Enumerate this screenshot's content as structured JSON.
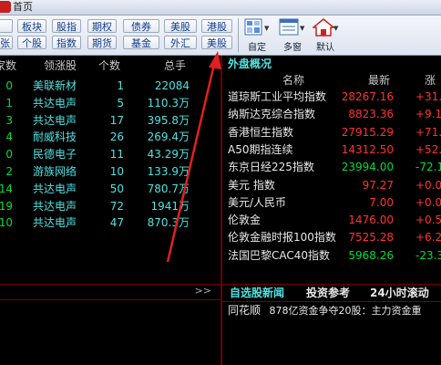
{
  "window": {
    "title_fragment": "首页",
    "logo_fragment": ""
  },
  "toolbar": {
    "row1": [
      "板块",
      "股指",
      "期权",
      "债券",
      "美股",
      "港股"
    ],
    "row2": [
      "个股",
      "指数",
      "期货",
      "基金",
      "外汇",
      "美股"
    ],
    "left_partial_row2": "张",
    "big_buttons": [
      {
        "label": "自定",
        "icon": "grid-icon"
      },
      {
        "label": "多窗",
        "icon": "multi-window-icon"
      },
      {
        "label": "默认",
        "icon": "home-icon"
      }
    ]
  },
  "left_table": {
    "headers": [
      "家数",
      "领涨股",
      "个数",
      "总手"
    ],
    "rows": [
      {
        "count": "0",
        "leader": "美联新材",
        "num": "1",
        "volume": "22084"
      },
      {
        "count": "1",
        "leader": "共达电声",
        "num": "5",
        "volume": "110.3万"
      },
      {
        "count": "3",
        "leader": "共达电声",
        "num": "17",
        "volume": "395.8万"
      },
      {
        "count": "4",
        "leader": "耐威科技",
        "num": "26",
        "volume": "269.4万"
      },
      {
        "count": "0",
        "leader": "民德电子",
        "num": "11",
        "volume": "43.29万"
      },
      {
        "count": "2",
        "leader": "游族网络",
        "num": "10",
        "volume": "133.9万"
      },
      {
        "count": "14",
        "leader": "共达电声",
        "num": "50",
        "volume": "780.7万"
      },
      {
        "count": "19",
        "leader": "共达电声",
        "num": "72",
        "volume": "1941万"
      },
      {
        "count": "10",
        "leader": "共达电声",
        "num": "47",
        "volume": "870.3万"
      }
    ],
    "more_label": ">>"
  },
  "right_table": {
    "title": "外盘概况",
    "headers": [
      "名称",
      "最新",
      "涨"
    ],
    "rows": [
      {
        "name": "道琼斯工业平均指数",
        "latest": "28267.16",
        "change": "+31.2",
        "latest_color": "red",
        "change_color": "red"
      },
      {
        "name": "纳斯达克综合指数",
        "latest": "8823.36",
        "change": "+9.1",
        "latest_color": "red",
        "change_color": "red"
      },
      {
        "name": "香港恒生指数",
        "latest": "27915.29",
        "change": "+71.5",
        "latest_color": "red",
        "change_color": "red"
      },
      {
        "name": "A50期指连续",
        "latest": "14312.50",
        "change": "+52.5",
        "latest_color": "red",
        "change_color": "red"
      },
      {
        "name": "东京日经225指数",
        "latest": "23994.00",
        "change": "-72.1",
        "latest_color": "green",
        "change_color": "green"
      },
      {
        "name": "美元 指数",
        "latest": "97.27",
        "change": "+0.0",
        "latest_color": "red",
        "change_color": "red"
      },
      {
        "name": "美元/人民币",
        "latest": "7.00",
        "change": "+0.0",
        "latest_color": "red",
        "change_color": "red"
      },
      {
        "name": "伦敦金",
        "latest": "1476.00",
        "change": "+0.5",
        "latest_color": "red",
        "change_color": "red"
      },
      {
        "name": "伦敦金融时报100指数",
        "latest": "7525.28",
        "change": "+6.2",
        "latest_color": "red",
        "change_color": "red"
      },
      {
        "name": "法国巴黎CAC40指数",
        "latest": "5968.26",
        "change": "-23.3",
        "latest_color": "green",
        "change_color": "green"
      }
    ]
  },
  "bottom_tabs": [
    "自选股新闻",
    "投资参考",
    "24小时滚动"
  ],
  "news": {
    "source": "同花顺",
    "headline": "878亿资金争夺20股：主力资金重"
  },
  "colors": {
    "accent_red": "#ff3232",
    "accent_green": "#00dc3c",
    "cyan": "#4ee3e3",
    "arrow_red": "#e02020"
  }
}
